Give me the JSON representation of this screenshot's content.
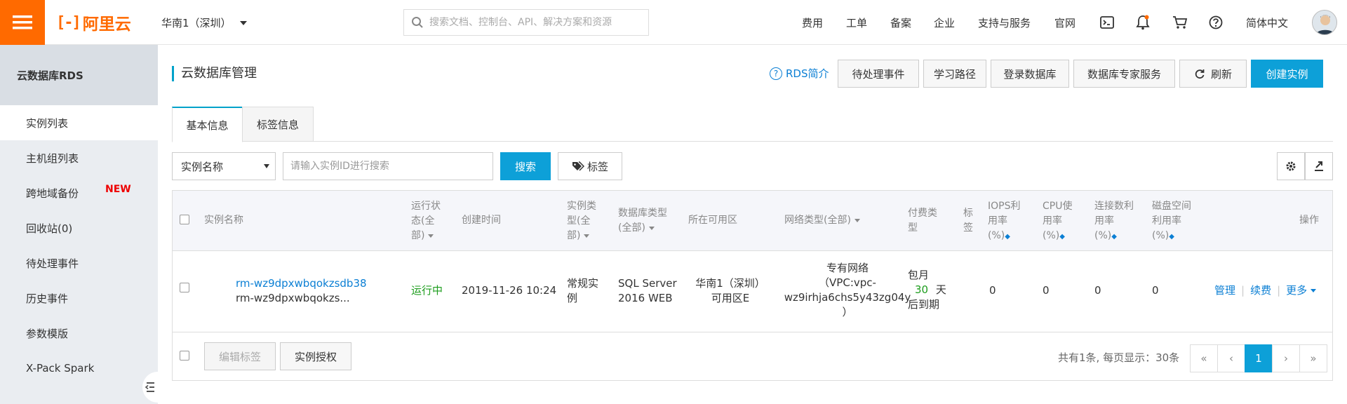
{
  "header": {
    "logo_text": "阿里云",
    "region": "华南1（深圳）",
    "search_placeholder": "搜索文档、控制台、API、解决方案和资源",
    "nav": [
      "费用",
      "工单",
      "备案",
      "企业",
      "支持与服务",
      "官网"
    ],
    "language": "简体中文"
  },
  "sidebar": {
    "title": "云数据库RDS",
    "items": [
      {
        "label": "实例列表"
      },
      {
        "label": "主机组列表"
      },
      {
        "label": "跨地域备份",
        "badge": "NEW"
      },
      {
        "label": "回收站(0)"
      },
      {
        "label": "待处理事件"
      },
      {
        "label": "历史事件"
      },
      {
        "label": "参数模版"
      },
      {
        "label": "X-Pack Spark"
      }
    ]
  },
  "page": {
    "title": "云数据库管理",
    "intro_link": "RDS简介",
    "buttons": {
      "pending_events": "待处理事件",
      "learning_path": "学习路径",
      "login_db": "登录数据库",
      "expert_service": "数据库专家服务",
      "refresh": "刷新",
      "create": "创建实例"
    },
    "tabs": [
      "基本信息",
      "标签信息"
    ],
    "filter": {
      "select_value": "实例名称",
      "search_placeholder": "请输入实例ID进行搜索",
      "search_button": "搜索",
      "tag_button": "标签"
    }
  },
  "table": {
    "headers": {
      "name": "实例名称",
      "status": [
        "运行状",
        "态(全",
        "部)"
      ],
      "created": "创建时间",
      "type": [
        "实例类",
        "型(全",
        "部)"
      ],
      "db_type": [
        "数据库类型",
        "(全部)"
      ],
      "zone": "所在可用区",
      "network": "网络类型(全部)",
      "pay": [
        "付费类",
        "型"
      ],
      "tag": [
        "标",
        "签"
      ],
      "iops": [
        "IOPS利",
        "用率",
        "(%)"
      ],
      "cpu": [
        "CPU使",
        "用率",
        "(%)"
      ],
      "conn": [
        "连接数利",
        "用率",
        "(%)"
      ],
      "disk": [
        "磁盘空间",
        "利用率",
        "(%)"
      ],
      "actions": "操作"
    },
    "rows": [
      {
        "id": "rm-wz9dpxwbqokzsdb38",
        "name": "rm-wz9dpxwbqokzs...",
        "status": "运行中",
        "created": "2019-11-26 10:24",
        "type": [
          "常规实",
          "例"
        ],
        "db_type": [
          "SQL Server",
          "2016 WEB"
        ],
        "zone": [
          "华南1（深圳）",
          "可用区E"
        ],
        "network": [
          "专有网络",
          "（VPC:vpc-",
          "wz9irhja6chs5y43zg04y",
          "）"
        ],
        "pay_type": "包月",
        "days": "30",
        "days_unit": "天",
        "expire": "后到期",
        "iops": "0",
        "cpu": "0",
        "conn": "0",
        "disk": "0",
        "actions": [
          "管理",
          "续费",
          "更多"
        ]
      }
    ],
    "footer": {
      "edit_tags": "编辑标签",
      "authorize": "实例授权",
      "summary": "共有1条, 每页显示：30条",
      "pager": [
        "«",
        "‹",
        "1",
        "›",
        "»"
      ]
    }
  },
  "colors": {
    "brand_orange": "#ff6a00",
    "primary_blue": "#0da0d8",
    "link_blue": "#0b7fd4",
    "status_green": "#1d9d1d",
    "new_red": "#ee0000"
  }
}
